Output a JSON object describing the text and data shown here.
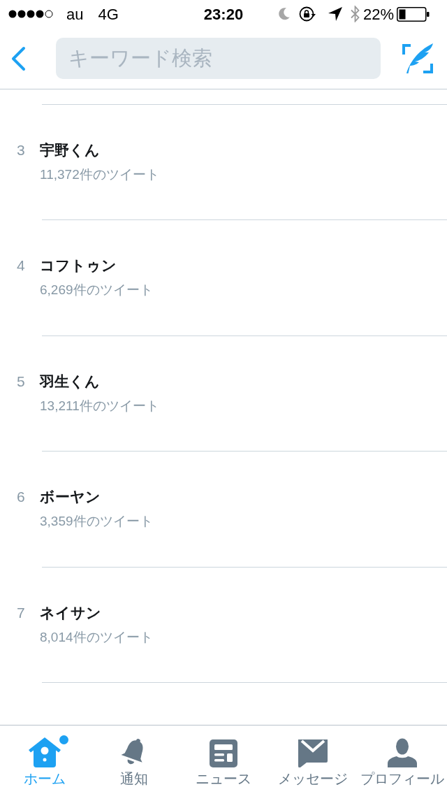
{
  "status_bar": {
    "carrier": "au",
    "network": "4G",
    "time": "23:20",
    "battery": "22%"
  },
  "nav_bar": {
    "search": {
      "placeholder": "キーワード検索"
    }
  },
  "trends": [
    {
      "rank": "3",
      "name": "宇野くん",
      "tweet_count": "11,372件のツイート"
    },
    {
      "rank": "4",
      "name": "コフトゥン",
      "tweet_count": "6,269件のツイート"
    },
    {
      "rank": "5",
      "name": "羽生くん",
      "tweet_count": "13,211件のツイート"
    },
    {
      "rank": "6",
      "name": "ボーヤン",
      "tweet_count": "3,359件のツイート"
    },
    {
      "rank": "7",
      "name": "ネイサン",
      "tweet_count": "8,014件のツイート"
    }
  ],
  "tab_bar": [
    {
      "label": "ホーム",
      "selected": true,
      "unread": true
    },
    {
      "label": "通知",
      "selected": false,
      "unread": false
    },
    {
      "label": "ニュース",
      "selected": false,
      "unread": false
    },
    {
      "label": "メッセージ",
      "selected": false,
      "unread": false
    },
    {
      "label": "プロフィール",
      "selected": false,
      "unread": false
    }
  ]
}
